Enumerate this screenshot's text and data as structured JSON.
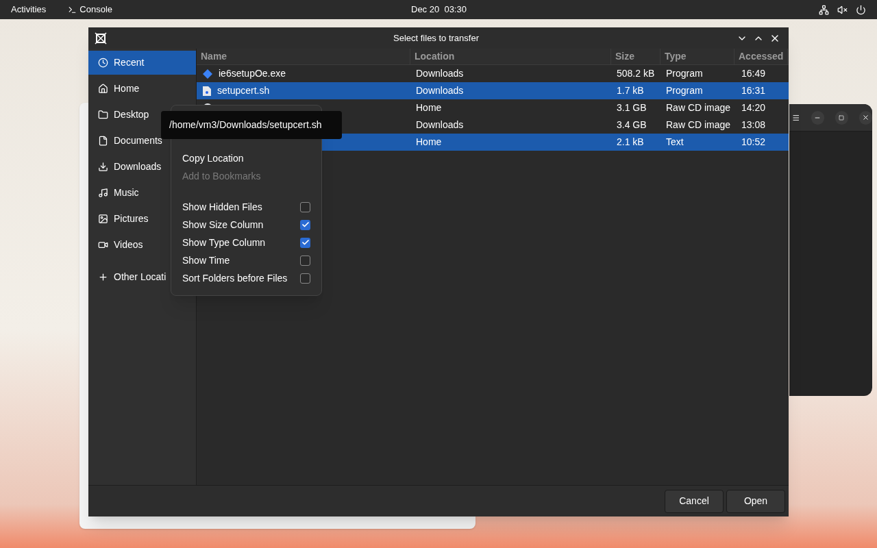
{
  "topbar": {
    "activities": "Activities",
    "app": "Console",
    "clock": "Dec 20  03:30"
  },
  "dialog": {
    "title": "Select files to transfer",
    "sidebar": [
      {
        "kind": "recent",
        "label": "Recent",
        "selected": true
      },
      {
        "kind": "home",
        "label": "Home",
        "selected": false
      },
      {
        "kind": "folder",
        "label": "Desktop",
        "selected": false
      },
      {
        "kind": "document",
        "label": "Documents",
        "selected": false
      },
      {
        "kind": "download",
        "label": "Downloads",
        "selected": false
      },
      {
        "kind": "music",
        "label": "Music",
        "selected": false
      },
      {
        "kind": "picture",
        "label": "Pictures",
        "selected": false
      },
      {
        "kind": "video",
        "label": "Videos",
        "selected": false
      },
      {
        "kind": "add",
        "label": "Other Locati",
        "selected": false
      }
    ],
    "columns": [
      "Name",
      "Location",
      "Size",
      "Type",
      "Accessed"
    ],
    "rows": [
      {
        "kind": "exe",
        "name": "ie6setupOe.exe",
        "location": "Downloads",
        "size": "508.2 kB",
        "type": "Program",
        "accessed": "16:49",
        "selected": false
      },
      {
        "kind": "script",
        "name": "setupcert.sh",
        "location": "Downloads",
        "size": "1.7 kB",
        "type": "Program",
        "accessed": "16:31",
        "selected": true
      },
      {
        "kind": "disc",
        "location": "Home",
        "size": "3.1 GB",
        "type": "Raw CD image",
        "accessed": "14:20",
        "selected": false
      },
      {
        "location": "Downloads",
        "size": "3.4 GB",
        "type": "Raw CD image",
        "accessed": "13:08",
        "selected": false
      },
      {
        "location": "Home",
        "size": "2.1 kB",
        "type": "Text",
        "accessed": "10:52",
        "selected": true
      }
    ],
    "menu": [
      {
        "kind": "separator"
      },
      {
        "kind": "action",
        "label": "Copy Location",
        "disabled": false
      },
      {
        "kind": "action",
        "label": "Add to Bookmarks",
        "disabled": true
      },
      {
        "kind": "separator"
      },
      {
        "kind": "toggle",
        "label": "Show Hidden Files",
        "checked": false
      },
      {
        "kind": "toggle",
        "label": "Show Size Column",
        "checked": true
      },
      {
        "kind": "toggle",
        "label": "Show Type Column",
        "checked": true
      },
      {
        "kind": "toggle",
        "label": "Show Time",
        "checked": false
      },
      {
        "kind": "toggle",
        "label": "Sort Folders before Files",
        "checked": false
      }
    ],
    "tooltip": "/home/vm3/Downloads/setupcert.sh",
    "buttons": [
      "Cancel",
      "Open"
    ]
  }
}
